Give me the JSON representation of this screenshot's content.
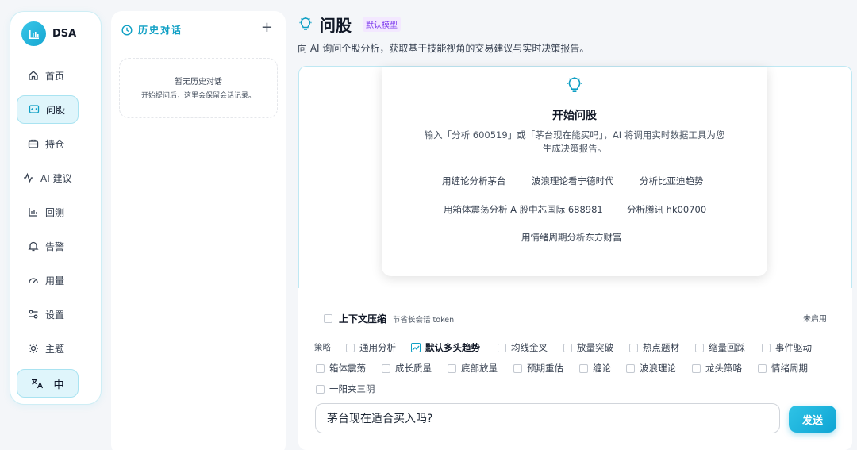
{
  "app": {
    "name": "DSA"
  },
  "sidebar": {
    "items": [
      {
        "label": "首页",
        "icon": "home-icon"
      },
      {
        "label": "问股",
        "icon": "chat-icon",
        "active": true
      },
      {
        "label": "持仓",
        "icon": "briefcase-icon"
      },
      {
        "label": "AI 建议",
        "icon": "activity-icon"
      },
      {
        "label": "回测",
        "icon": "bar-chart-icon"
      },
      {
        "label": "告警",
        "icon": "bell-icon"
      },
      {
        "label": "用量",
        "icon": "gauge-icon"
      },
      {
        "label": "设置",
        "icon": "settings-icon"
      },
      {
        "label": "主题",
        "icon": "sun-icon"
      }
    ],
    "language_label": "中"
  },
  "history": {
    "title": "历史对话",
    "add_label": "+",
    "empty_title": "暂无历史对话",
    "empty_desc": "开始提问后，这里会保留会话记录。"
  },
  "header": {
    "title": "问股",
    "model_badge": "默认模型",
    "subtitle": "向 AI 询问个股分析，获取基于技能视角的交易建议与实时决策报告。"
  },
  "welcome": {
    "title": "开始问股",
    "description": "输入「分析 600519」或「茅台现在能买吗」，AI 将调用实时数据工具为您生成决策报告。",
    "suggestions": [
      "用缠论分析茅台",
      "波浪理论看宁德时代",
      "分析比亚迪趋势",
      "用箱体震荡分析 A 股中芯国际 688981",
      "分析腾讯 hk00700",
      "用情绪周期分析东方财富"
    ]
  },
  "context": {
    "label": "上下文压缩",
    "note": "节省长会话 token",
    "status": "未启用"
  },
  "strategies": {
    "label": "策略",
    "items": [
      {
        "label": "通用分析",
        "selected": false
      },
      {
        "label": "默认多头趋势",
        "selected": true
      },
      {
        "label": "均线金叉",
        "selected": false
      },
      {
        "label": "放量突破",
        "selected": false
      },
      {
        "label": "热点题材",
        "selected": false
      },
      {
        "label": "缩量回踩",
        "selected": false
      },
      {
        "label": "事件驱动",
        "selected": false
      },
      {
        "label": "箱体震荡",
        "selected": false
      },
      {
        "label": "成长质量",
        "selected": false
      },
      {
        "label": "底部放量",
        "selected": false
      },
      {
        "label": "预期重估",
        "selected": false
      },
      {
        "label": "缠论",
        "selected": false
      },
      {
        "label": "波浪理论",
        "selected": false
      },
      {
        "label": "龙头策略",
        "selected": false
      },
      {
        "label": "情绪周期",
        "selected": false
      },
      {
        "label": "一阳夹三阴",
        "selected": false
      }
    ]
  },
  "composer": {
    "value": "茅台现在适合买入吗?",
    "send_label": "发送"
  },
  "colors": {
    "accent": "#14b8d8",
    "badge": "#7c3aed"
  }
}
